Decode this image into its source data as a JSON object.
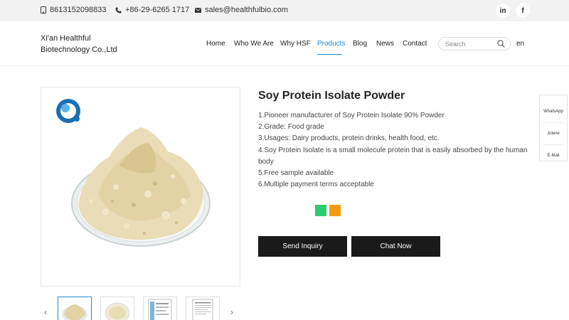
{
  "topbar": {
    "phone": "8613152098833",
    "tel": "+86-29-6265 1717",
    "email": "sales@healthfulbio.com",
    "social": [
      {
        "label": "in",
        "icon": "linkedin-icon"
      },
      {
        "label": "f",
        "icon": "facebook-icon"
      }
    ]
  },
  "header": {
    "company_line1": "Xi'an Healthful",
    "company_line2": "Biotechnology Co.,Ltd",
    "nav": [
      {
        "label": "Home",
        "active": false
      },
      {
        "label": "Who We Are",
        "active": false
      },
      {
        "label": "Why HSF",
        "active": false
      },
      {
        "label": "Products",
        "active": true
      },
      {
        "label": "Blog",
        "active": false
      },
      {
        "label": "News",
        "active": false
      },
      {
        "label": "Contact",
        "active": false
      }
    ],
    "search_placeholder": "Search",
    "language": "en"
  },
  "product": {
    "title": "Soy Protein Isolate Powder",
    "features": [
      "1.Pioneer manufacturer of Soy Protein Isolate 90% Powder",
      "2.Grade: Food grade",
      "3.Usages: Dairy products, protein drinks, health food, etc.",
      "4.Soy Protein Isolate is a small molecule protein that is easily absorbed by the human body",
      "5.Free sample available",
      "6.Multiple payment terms acceptable"
    ],
    "share_colors": [
      "#2ecc71",
      "#f39c12"
    ],
    "inquiry_label": "Send Inquiry",
    "chat_label": "Chat Now"
  },
  "gallery": {
    "prev": "‹",
    "next": "›",
    "thumb_count": 4
  },
  "side": {
    "items": [
      "WhatsApp",
      "Jolene",
      "E-Mail"
    ]
  },
  "colors": {
    "accent": "#1e88d8",
    "button": "#1a1a1a",
    "topbar": "#f2f2f2"
  }
}
